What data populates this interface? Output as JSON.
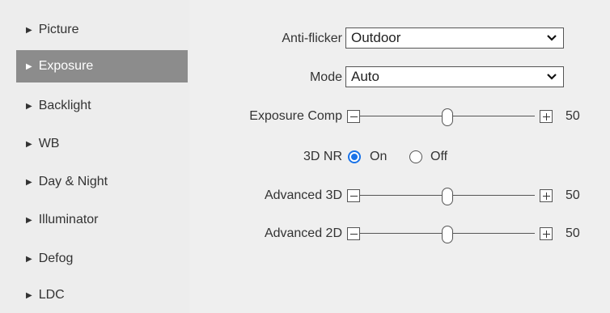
{
  "sidebar": {
    "items": [
      {
        "label": "Picture",
        "active": false
      },
      {
        "label": "Exposure",
        "active": true
      },
      {
        "label": "Backlight",
        "active": false
      },
      {
        "label": "WB",
        "active": false
      },
      {
        "label": "Day & Night",
        "active": false
      },
      {
        "label": "Illuminator",
        "active": false
      },
      {
        "label": "Defog",
        "active": false
      },
      {
        "label": "LDC",
        "active": false
      }
    ]
  },
  "settings": {
    "anti_flicker": {
      "label": "Anti-flicker",
      "value": "Outdoor"
    },
    "mode": {
      "label": "Mode",
      "value": "Auto"
    },
    "exposure_comp": {
      "label": "Exposure Comp",
      "value": "50",
      "level": 0.5
    },
    "nr3d": {
      "label": "3D NR",
      "on_label": "On",
      "off_label": "Off",
      "selected": "On"
    },
    "advanced_3d": {
      "label": "Advanced 3D",
      "value": "50",
      "level": 0.5
    },
    "advanced_2d": {
      "label": "Advanced 2D",
      "value": "50",
      "level": 0.5
    }
  },
  "colors": {
    "accent": "#1a73e8",
    "active_nav": "#8c8c8c"
  }
}
